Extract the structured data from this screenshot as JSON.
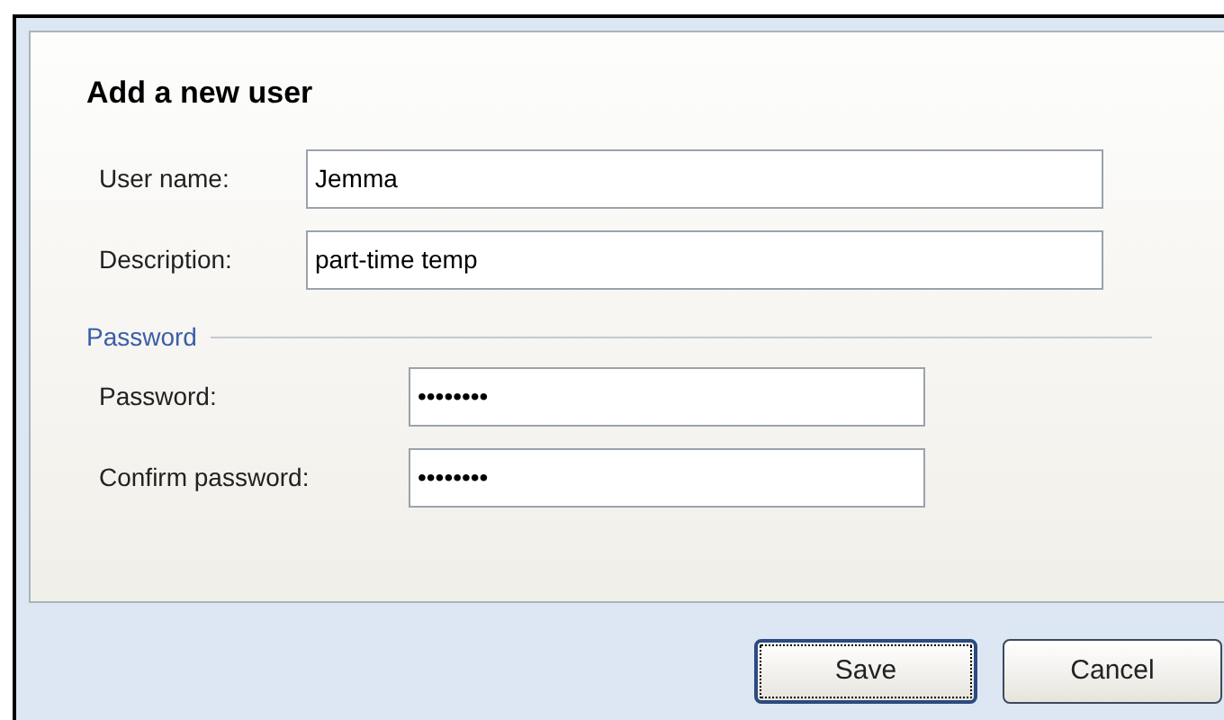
{
  "dialog": {
    "title": "Add a new user"
  },
  "fields": [
    {
      "label": "User name:",
      "value": "Jemma"
    },
    {
      "label": "Description:",
      "value": "part-time temp"
    }
  ],
  "password_section": {
    "title": "Password",
    "fields": [
      {
        "label": "Password:",
        "value": "••••••••"
      },
      {
        "label": "Confirm password:",
        "value": "••••••••"
      }
    ]
  },
  "buttons": [
    {
      "label": "Save",
      "focused": true
    },
    {
      "label": "Cancel",
      "focused": false
    }
  ]
}
